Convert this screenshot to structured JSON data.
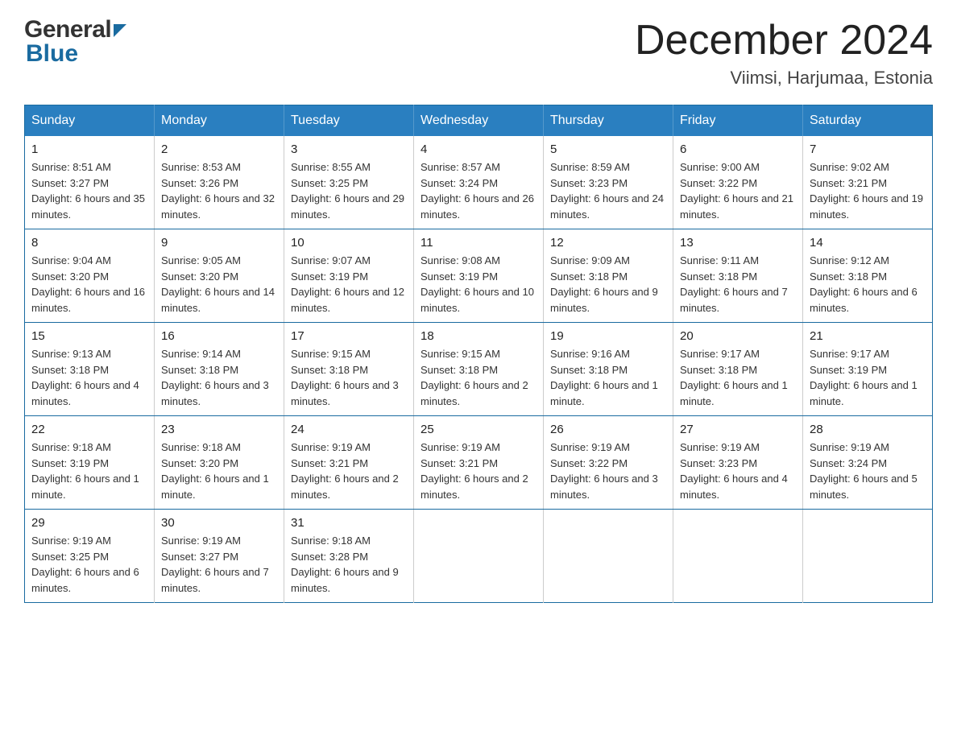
{
  "header": {
    "logo": {
      "general": "General",
      "blue": "Blue"
    },
    "title": "December 2024",
    "location": "Viimsi, Harjumaa, Estonia"
  },
  "calendar": {
    "days_of_week": [
      "Sunday",
      "Monday",
      "Tuesday",
      "Wednesday",
      "Thursday",
      "Friday",
      "Saturday"
    ],
    "weeks": [
      [
        {
          "day": "1",
          "sunrise": "Sunrise: 8:51 AM",
          "sunset": "Sunset: 3:27 PM",
          "daylight": "Daylight: 6 hours and 35 minutes."
        },
        {
          "day": "2",
          "sunrise": "Sunrise: 8:53 AM",
          "sunset": "Sunset: 3:26 PM",
          "daylight": "Daylight: 6 hours and 32 minutes."
        },
        {
          "day": "3",
          "sunrise": "Sunrise: 8:55 AM",
          "sunset": "Sunset: 3:25 PM",
          "daylight": "Daylight: 6 hours and 29 minutes."
        },
        {
          "day": "4",
          "sunrise": "Sunrise: 8:57 AM",
          "sunset": "Sunset: 3:24 PM",
          "daylight": "Daylight: 6 hours and 26 minutes."
        },
        {
          "day": "5",
          "sunrise": "Sunrise: 8:59 AM",
          "sunset": "Sunset: 3:23 PM",
          "daylight": "Daylight: 6 hours and 24 minutes."
        },
        {
          "day": "6",
          "sunrise": "Sunrise: 9:00 AM",
          "sunset": "Sunset: 3:22 PM",
          "daylight": "Daylight: 6 hours and 21 minutes."
        },
        {
          "day": "7",
          "sunrise": "Sunrise: 9:02 AM",
          "sunset": "Sunset: 3:21 PM",
          "daylight": "Daylight: 6 hours and 19 minutes."
        }
      ],
      [
        {
          "day": "8",
          "sunrise": "Sunrise: 9:04 AM",
          "sunset": "Sunset: 3:20 PM",
          "daylight": "Daylight: 6 hours and 16 minutes."
        },
        {
          "day": "9",
          "sunrise": "Sunrise: 9:05 AM",
          "sunset": "Sunset: 3:20 PM",
          "daylight": "Daylight: 6 hours and 14 minutes."
        },
        {
          "day": "10",
          "sunrise": "Sunrise: 9:07 AM",
          "sunset": "Sunset: 3:19 PM",
          "daylight": "Daylight: 6 hours and 12 minutes."
        },
        {
          "day": "11",
          "sunrise": "Sunrise: 9:08 AM",
          "sunset": "Sunset: 3:19 PM",
          "daylight": "Daylight: 6 hours and 10 minutes."
        },
        {
          "day": "12",
          "sunrise": "Sunrise: 9:09 AM",
          "sunset": "Sunset: 3:18 PM",
          "daylight": "Daylight: 6 hours and 9 minutes."
        },
        {
          "day": "13",
          "sunrise": "Sunrise: 9:11 AM",
          "sunset": "Sunset: 3:18 PM",
          "daylight": "Daylight: 6 hours and 7 minutes."
        },
        {
          "day": "14",
          "sunrise": "Sunrise: 9:12 AM",
          "sunset": "Sunset: 3:18 PM",
          "daylight": "Daylight: 6 hours and 6 minutes."
        }
      ],
      [
        {
          "day": "15",
          "sunrise": "Sunrise: 9:13 AM",
          "sunset": "Sunset: 3:18 PM",
          "daylight": "Daylight: 6 hours and 4 minutes."
        },
        {
          "day": "16",
          "sunrise": "Sunrise: 9:14 AM",
          "sunset": "Sunset: 3:18 PM",
          "daylight": "Daylight: 6 hours and 3 minutes."
        },
        {
          "day": "17",
          "sunrise": "Sunrise: 9:15 AM",
          "sunset": "Sunset: 3:18 PM",
          "daylight": "Daylight: 6 hours and 3 minutes."
        },
        {
          "day": "18",
          "sunrise": "Sunrise: 9:15 AM",
          "sunset": "Sunset: 3:18 PM",
          "daylight": "Daylight: 6 hours and 2 minutes."
        },
        {
          "day": "19",
          "sunrise": "Sunrise: 9:16 AM",
          "sunset": "Sunset: 3:18 PM",
          "daylight": "Daylight: 6 hours and 1 minute."
        },
        {
          "day": "20",
          "sunrise": "Sunrise: 9:17 AM",
          "sunset": "Sunset: 3:18 PM",
          "daylight": "Daylight: 6 hours and 1 minute."
        },
        {
          "day": "21",
          "sunrise": "Sunrise: 9:17 AM",
          "sunset": "Sunset: 3:19 PM",
          "daylight": "Daylight: 6 hours and 1 minute."
        }
      ],
      [
        {
          "day": "22",
          "sunrise": "Sunrise: 9:18 AM",
          "sunset": "Sunset: 3:19 PM",
          "daylight": "Daylight: 6 hours and 1 minute."
        },
        {
          "day": "23",
          "sunrise": "Sunrise: 9:18 AM",
          "sunset": "Sunset: 3:20 PM",
          "daylight": "Daylight: 6 hours and 1 minute."
        },
        {
          "day": "24",
          "sunrise": "Sunrise: 9:19 AM",
          "sunset": "Sunset: 3:21 PM",
          "daylight": "Daylight: 6 hours and 2 minutes."
        },
        {
          "day": "25",
          "sunrise": "Sunrise: 9:19 AM",
          "sunset": "Sunset: 3:21 PM",
          "daylight": "Daylight: 6 hours and 2 minutes."
        },
        {
          "day": "26",
          "sunrise": "Sunrise: 9:19 AM",
          "sunset": "Sunset: 3:22 PM",
          "daylight": "Daylight: 6 hours and 3 minutes."
        },
        {
          "day": "27",
          "sunrise": "Sunrise: 9:19 AM",
          "sunset": "Sunset: 3:23 PM",
          "daylight": "Daylight: 6 hours and 4 minutes."
        },
        {
          "day": "28",
          "sunrise": "Sunrise: 9:19 AM",
          "sunset": "Sunset: 3:24 PM",
          "daylight": "Daylight: 6 hours and 5 minutes."
        }
      ],
      [
        {
          "day": "29",
          "sunrise": "Sunrise: 9:19 AM",
          "sunset": "Sunset: 3:25 PM",
          "daylight": "Daylight: 6 hours and 6 minutes."
        },
        {
          "day": "30",
          "sunrise": "Sunrise: 9:19 AM",
          "sunset": "Sunset: 3:27 PM",
          "daylight": "Daylight: 6 hours and 7 minutes."
        },
        {
          "day": "31",
          "sunrise": "Sunrise: 9:18 AM",
          "sunset": "Sunset: 3:28 PM",
          "daylight": "Daylight: 6 hours and 9 minutes."
        },
        null,
        null,
        null,
        null
      ]
    ]
  }
}
